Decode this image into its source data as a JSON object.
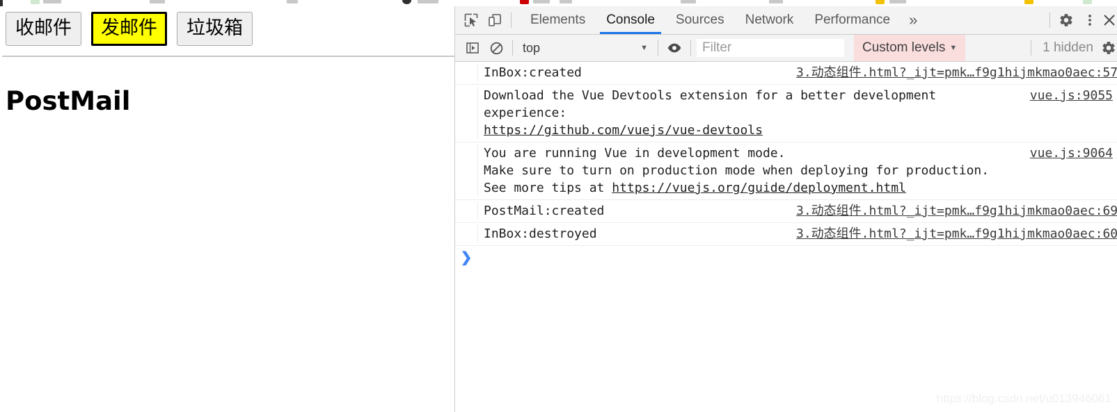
{
  "page": {
    "buttons": [
      {
        "label": "收邮件",
        "active": false
      },
      {
        "label": "发邮件",
        "active": true
      },
      {
        "label": "垃圾箱",
        "active": false
      }
    ],
    "title": "PostMail"
  },
  "devtools": {
    "toolbar": {
      "inspect_icon": "inspect-element-icon",
      "device_icon": "device-toolbar-icon",
      "settings_icon": "gear-icon",
      "more_icon": "more-vertical-icon",
      "close_icon": "close-icon"
    },
    "tabs": [
      {
        "label": "Elements",
        "active": false
      },
      {
        "label": "Console",
        "active": true
      },
      {
        "label": "Sources",
        "active": false
      },
      {
        "label": "Network",
        "active": false
      },
      {
        "label": "Performance",
        "active": false
      }
    ],
    "overflow_label": "»",
    "filterbar": {
      "sidebar_icon": "console-sidebar-icon",
      "clear_icon": "clear-console-icon",
      "context": "top",
      "context_caret": "▼",
      "eye_icon": "live-expression-eye-icon",
      "filter_placeholder": "Filter",
      "filter_value": "",
      "levels_label": "Custom levels",
      "levels_caret": "▼",
      "hidden_count": "1 hidden",
      "settings_icon": "gear-icon",
      "levels_bg": "#fadddd"
    },
    "messages": [
      {
        "text": "InBox:created",
        "link": "3.动态组件.html?_ijt=pmk…f9g1hijmkmao0aec:57",
        "link_style": "fixed"
      },
      {
        "text": "Download the Vue Devtools extension for a better development experience:\nhttps://github.com/vuejs/vue-devtools",
        "link": "vue.js:9055",
        "link_style": "right"
      },
      {
        "text": "You are running Vue in development mode.\nMake sure to turn on production mode when deploying for production.\nSee more tips at https://vuejs.org/guide/deployment.html",
        "link": "vue.js:9064",
        "link_style": "right"
      },
      {
        "text": "PostMail:created",
        "link": "3.动态组件.html?_ijt=pmk…f9g1hijmkmao0aec:69",
        "link_style": "fixed"
      },
      {
        "text": "InBox:destroyed",
        "link": "3.动态组件.html?_ijt=pmk…f9g1hijmkmao0aec:60",
        "link_style": "fixed"
      }
    ],
    "prompt_chevron": "❯"
  },
  "watermark": "https://blog.csdn.net/u013946061",
  "colors": {
    "accent_blue": "#1a73e8",
    "active_button_bg": "#ffff00",
    "levels_pink": "#fadddd",
    "prompt_blue": "#4285f4"
  }
}
